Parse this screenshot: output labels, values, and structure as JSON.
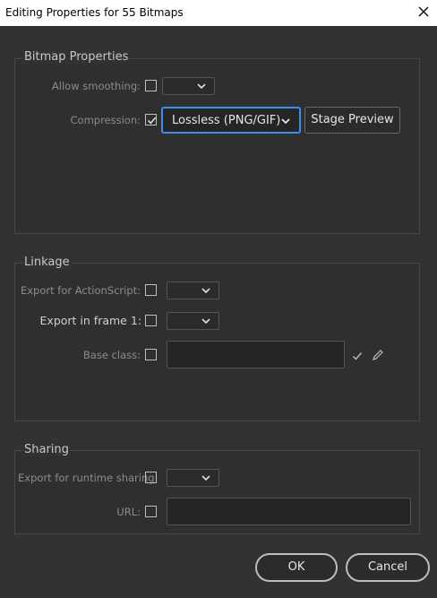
{
  "window": {
    "title": "Editing Properties for 55 Bitmaps"
  },
  "bitmap": {
    "title": "Bitmap Properties",
    "allow_smoothing_label": "Allow smoothing:",
    "compression_label": "Compression:",
    "compression_value": "Lossless (PNG/GIF)",
    "stage_preview_label": "Stage Preview"
  },
  "linkage": {
    "title": "Linkage",
    "export_as_label": "Export for ActionScript:",
    "export_frame_label": "Export in frame 1:",
    "base_class_label": "Base class:"
  },
  "sharing": {
    "title": "Sharing",
    "runtime_label": "Export for runtime sharing:",
    "url_label": "URL:"
  },
  "footer": {
    "ok_label": "OK",
    "cancel_label": "Cancel"
  }
}
